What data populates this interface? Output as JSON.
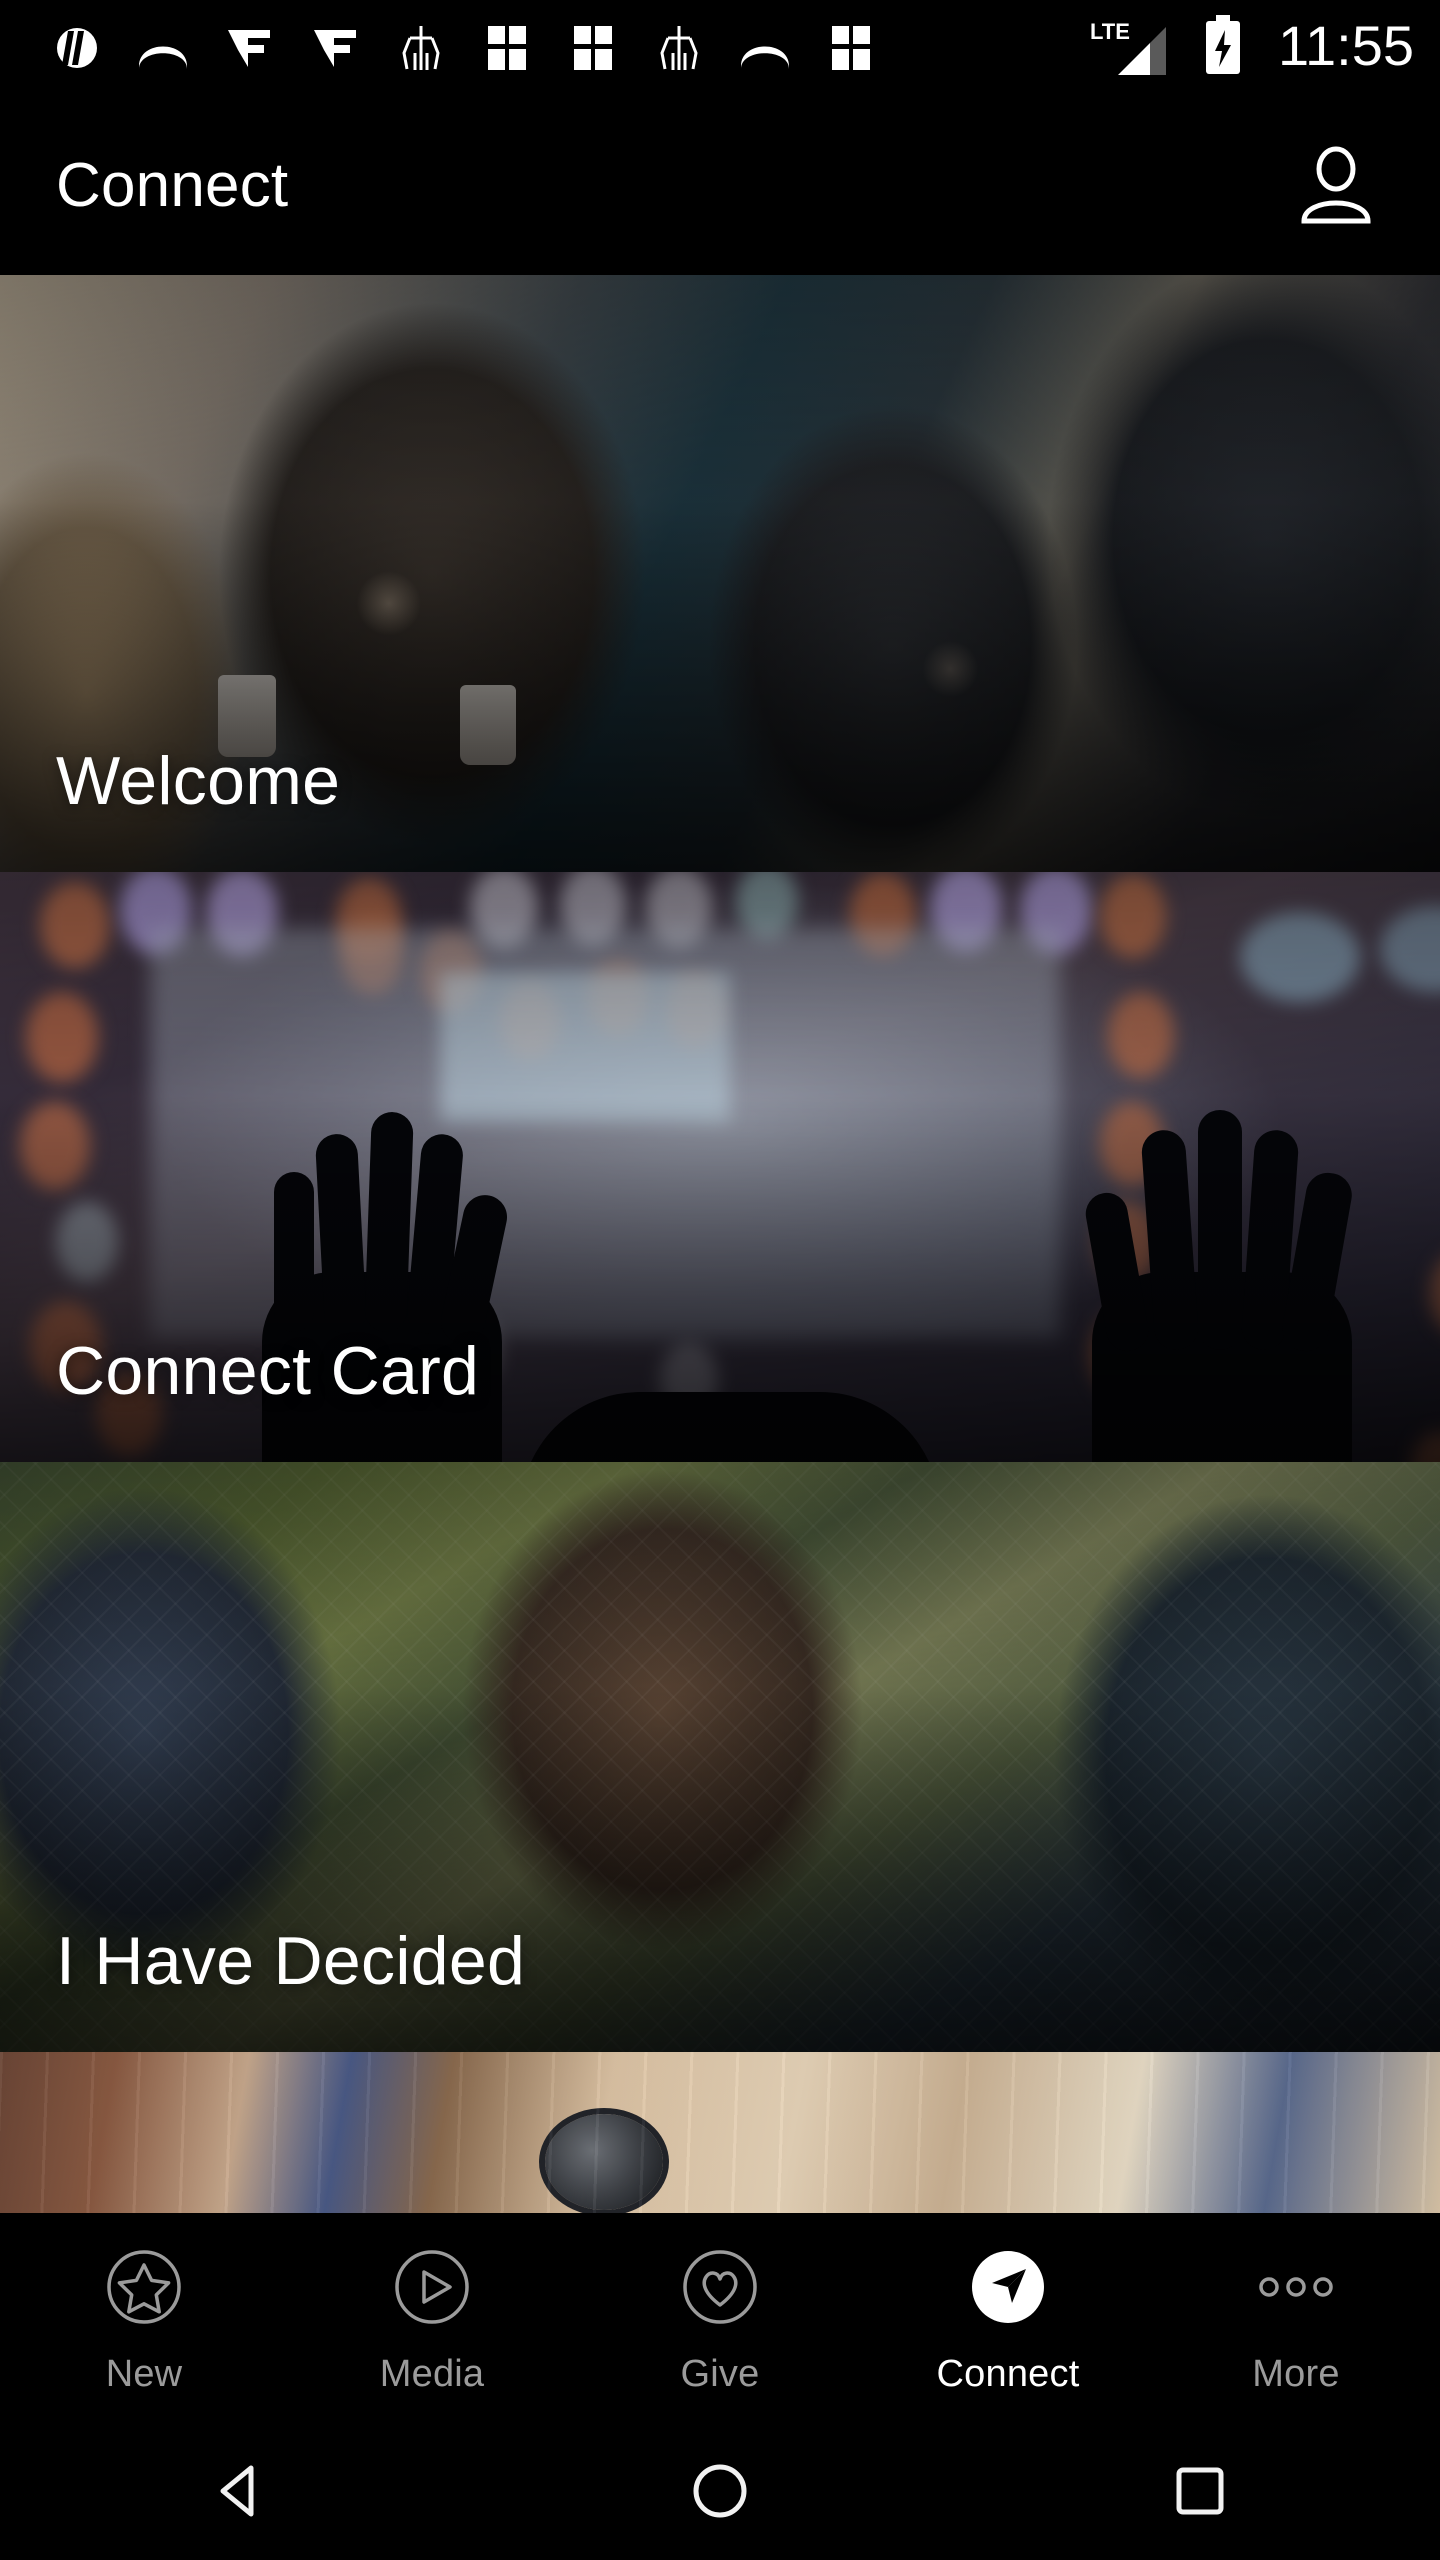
{
  "status_bar": {
    "time": "11:55",
    "network_type": "LTE",
    "notification_icons": [
      "church-app-notification-icon",
      "arch-bridge-notification-icon",
      "vf-logo-notification-icon",
      "vf-logo-notification-icon",
      "cross-banner-notification-icon",
      "window-panes-notification-icon",
      "window-panes-notification-icon",
      "cross-banner-notification-icon",
      "arch-bridge-notification-icon",
      "window-panes-notification-icon"
    ],
    "signal_icon": "cellular-signal-icon",
    "battery_icon": "battery-charging-icon"
  },
  "app_bar": {
    "title": "Connect",
    "account_icon": "person-account-icon"
  },
  "cards": [
    {
      "label": "Welcome",
      "art_name": "welcome-photo-people-talking-lobby"
    },
    {
      "label": "Connect Card",
      "art_name": "connect-card-photo-worship-raised-hands"
    },
    {
      "label": "I Have Decided",
      "art_name": "i-have-decided-photo-people-outdoors"
    },
    {
      "label": "",
      "art_name": "partial-photo-hands-together-wood-floor"
    }
  ],
  "tab_bar": {
    "items": [
      {
        "label": "New",
        "icon": "star-circle-icon",
        "active": false
      },
      {
        "label": "Media",
        "icon": "play-circle-icon",
        "active": false
      },
      {
        "label": "Give",
        "icon": "heart-circle-icon",
        "active": false
      },
      {
        "label": "Connect",
        "icon": "compass-navigate-icon",
        "active": true
      },
      {
        "label": "More",
        "icon": "more-dots-icon",
        "active": false
      }
    ]
  },
  "nav_bar": {
    "back": "back-triangle-icon",
    "home": "home-circle-icon",
    "recents": "recents-square-icon"
  },
  "colors": {
    "background": "#000000",
    "text_primary": "#ffffff",
    "text_muted": "#9b9b9b",
    "accent": "#ffffff"
  }
}
